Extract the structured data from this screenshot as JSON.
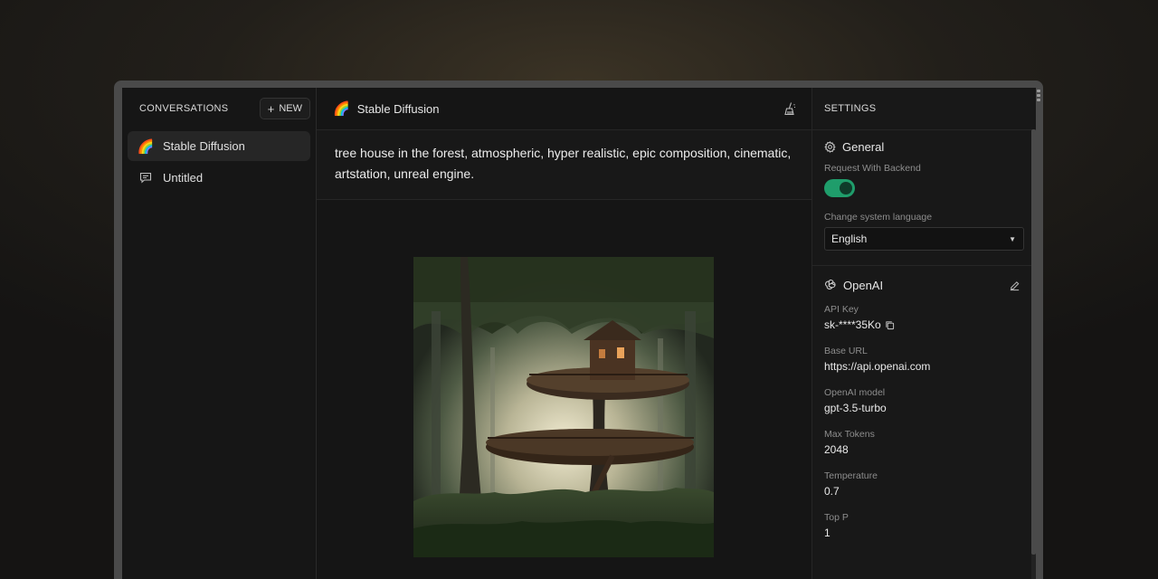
{
  "sidebar": {
    "title": "CONVERSATIONS",
    "new_button": "NEW",
    "items": [
      {
        "icon": "rainbow-emoji",
        "glyph": "🌈",
        "label": "Stable Diffusion",
        "active": true
      },
      {
        "icon": "message-icon",
        "label": "Untitled",
        "active": false
      }
    ]
  },
  "main": {
    "title_glyph": "🌈",
    "title": "Stable Diffusion",
    "prompt": "tree house in the forest, atmospheric, hyper realistic, epic composition, cinematic, artstation, unreal engine."
  },
  "settings": {
    "title": "SETTINGS",
    "general": {
      "title": "General",
      "request_label": "Request With Backend",
      "request_enabled": true,
      "language_label": "Change system language",
      "language_value": "English"
    },
    "openai": {
      "title": "OpenAI",
      "fields": [
        {
          "label": "API Key",
          "value": "sk-****35Ko"
        },
        {
          "label": "Base URL",
          "value": "https://api.openai.com"
        },
        {
          "label": "OpenAI model",
          "value": "gpt-3.5-turbo"
        },
        {
          "label": "Max Tokens",
          "value": "2048"
        },
        {
          "label": "Temperature",
          "value": "0.7"
        },
        {
          "label": "Top P",
          "value": "1"
        }
      ]
    }
  },
  "colors": {
    "accent": "#1f9d6b",
    "background": "#171717"
  }
}
